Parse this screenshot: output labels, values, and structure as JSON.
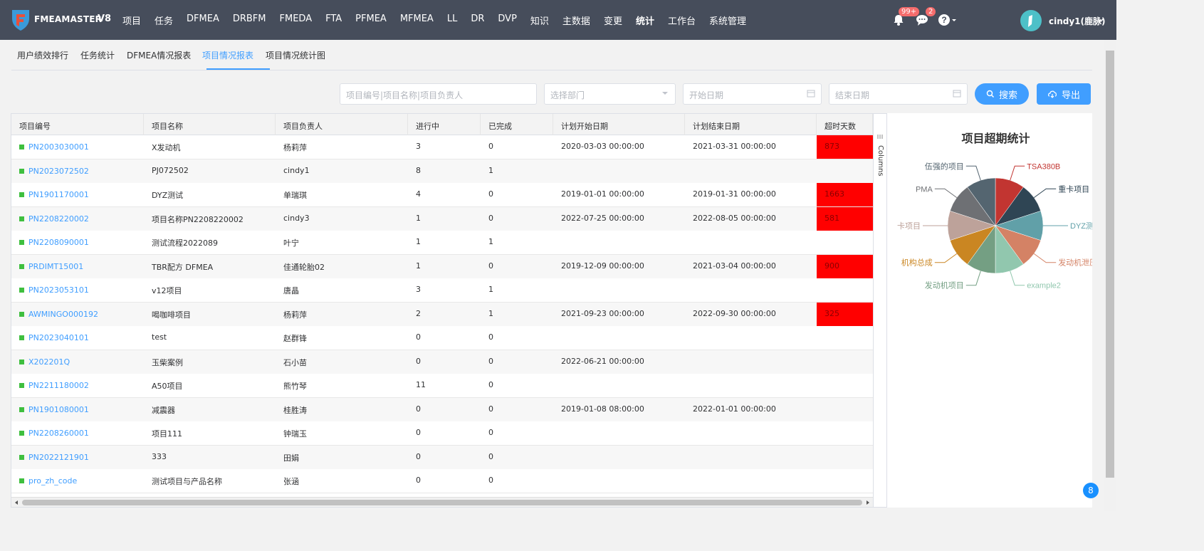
{
  "app": {
    "brand": "FMEAMASTER",
    "version": "V8"
  },
  "nav": [
    "项目",
    "任务",
    "DFMEA",
    "DRBFM",
    "FMEDA",
    "FTA",
    "PFMEA",
    "MFMEA",
    "LL",
    "DR",
    "DVP",
    "知识",
    "主数据",
    "变更",
    "统计",
    "工作台",
    "系统管理"
  ],
  "nav_active": "统计",
  "notifications": {
    "bell_count": "99+",
    "chat_count": "2"
  },
  "user": {
    "name": "cindy1(鹿脉)"
  },
  "tabs": [
    "用户绩效排行",
    "任务统计",
    "DFMEA情况报表",
    "项目情况报表",
    "项目情况统计图"
  ],
  "tab_active": "项目情况报表",
  "filters": {
    "keyword_placeholder": "项目编号|项目名称|项目负责人",
    "dept_placeholder": "选择部门",
    "start_placeholder": "开始日期",
    "end_placeholder": "结束日期",
    "search_label": "搜索",
    "export_label": "导出"
  },
  "table": {
    "headers": [
      "项目编号",
      "项目名称",
      "项目负责人",
      "进行中",
      "已完成",
      "计划开始日期",
      "计划结束日期",
      "超时天数"
    ],
    "rows": [
      [
        "PN2003030001",
        "X发动机",
        "杨莉萍",
        "3",
        "0",
        "2020-03-03 00:00:00",
        "2021-03-31 00:00:00",
        "873"
      ],
      [
        "PN2023072502",
        "PJ072502",
        "cindy1",
        "8",
        "1",
        "",
        "",
        ""
      ],
      [
        "PN1901170001",
        "DYZ测试",
        "单瑞琪",
        "4",
        "0",
        "2019-01-01 00:00:00",
        "2019-01-31 00:00:00",
        "1663"
      ],
      [
        "PN2208220002",
        "项目名称PN2208220002",
        "cindy3",
        "1",
        "0",
        "2022-07-25 00:00:00",
        "2022-08-05 00:00:00",
        "581"
      ],
      [
        "PN2208090001",
        "测试流程2022089",
        "叶宁",
        "1",
        "1",
        "",
        "",
        ""
      ],
      [
        "PRDIMT15001",
        "TBR配方 DFMEA",
        "佳通轮胎02",
        "1",
        "0",
        "2019-12-09 00:00:00",
        "2021-03-04 00:00:00",
        "900"
      ],
      [
        "PN2023053101",
        "v12项目",
        "唐晶",
        "3",
        "1",
        "",
        "",
        ""
      ],
      [
        "AWMINGO000192",
        "喝咖啡项目",
        "杨莉萍",
        "2",
        "1",
        "2021-09-23 00:00:00",
        "2022-09-30 00:00:00",
        "325"
      ],
      [
        "PN2023040101",
        "test",
        "赵群锋",
        "0",
        "0",
        "",
        "",
        ""
      ],
      [
        "X202201Q",
        "玉柴案例",
        "石小苗",
        "0",
        "0",
        "2022-06-21 00:00:00",
        "",
        ""
      ],
      [
        "PN2211180002",
        "A50项目",
        "熊竹琴",
        "11",
        "0",
        "",
        "",
        ""
      ],
      [
        "PN1901080001",
        "减震器",
        "桂胜涛",
        "0",
        "0",
        "2019-01-08 08:00:00",
        "2022-01-01 00:00:00",
        ""
      ],
      [
        "PN2208260001",
        "项目111",
        "钟瑞玉",
        "0",
        "0",
        "",
        "",
        ""
      ],
      [
        "PN2022121901",
        "333",
        "田娟",
        "0",
        "0",
        "",
        "",
        ""
      ],
      [
        "pro_zh_code",
        "测试项目与产品名称",
        "张涵",
        "0",
        "0",
        "",
        "",
        ""
      ]
    ]
  },
  "columns_label": "Columns",
  "page_badge": "8",
  "chart_data": {
    "type": "pie",
    "title": "项目超期统计",
    "labels": [
      "TSA380B",
      "重卡项目",
      "DYZ测试",
      "发动机泄压",
      "example2",
      "发动机项目",
      "机构总成",
      "卡项目",
      "PMA",
      "伍强的项目"
    ],
    "values": [
      10,
      10,
      10,
      10,
      10,
      10,
      10,
      10,
      10,
      10
    ],
    "colors": [
      "#c23531",
      "#2f4554",
      "#61a0a8",
      "#d48265",
      "#91c7ae",
      "#749f83",
      "#ca8622",
      "#bda29a",
      "#6e7074",
      "#546570"
    ]
  }
}
